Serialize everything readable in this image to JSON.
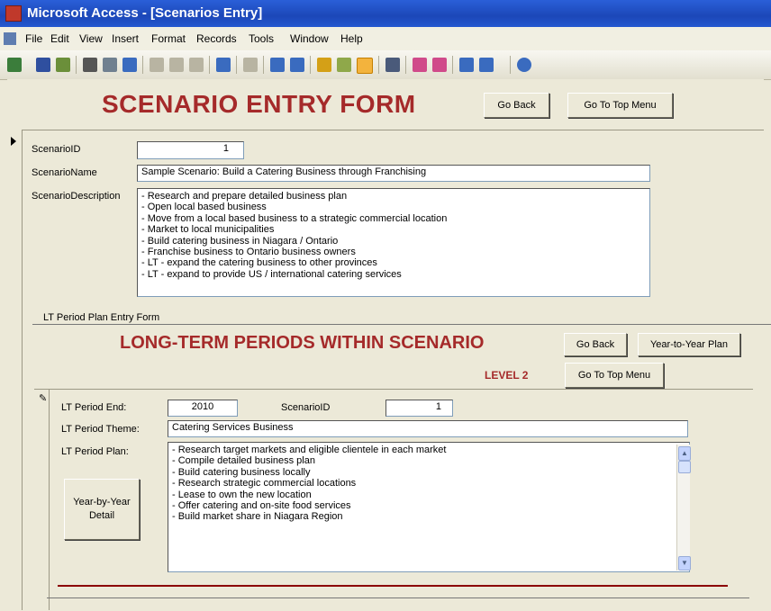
{
  "window": {
    "title": "Microsoft Access - [Scenarios Entry]"
  },
  "menu": [
    "File",
    "Edit",
    "View",
    "Insert",
    "Format",
    "Records",
    "Tools",
    "Window",
    "Help"
  ],
  "toolbar": {
    "icons": [
      "view-icon",
      "save-icon",
      "search-icon",
      "print-icon",
      "print-preview-icon",
      "spelling-icon",
      "cut-icon",
      "copy-icon",
      "paste-icon",
      "undo-icon",
      "insert-hyperlink-icon",
      "sort-ascending-icon",
      "sort-descending-icon",
      "filter-by-selection-icon",
      "filter-by-form-icon",
      "apply-filter-icon",
      "find-icon",
      "new-record-icon",
      "delete-record-icon",
      "database-window-icon",
      "new-object-icon",
      "help-icon"
    ]
  },
  "form": {
    "title": "SCENARIO ENTRY FORM",
    "go_back": "Go Back",
    "go_top_menu": "Go To Top Menu",
    "fields": {
      "scenario_id_label": "ScenarioID",
      "scenario_id_value": "1",
      "scenario_name_label": "ScenarioName",
      "scenario_name_value": "Sample Scenario:  Build a Catering Business through Franchising",
      "scenario_desc_label": "ScenarioDescription",
      "scenario_desc_lines": [
        "- Research and prepare detailed business plan",
        "- Open local based business",
        "- Move from a local based business to a strategic commercial location",
        "- Market to local municipalities",
        "- Build catering business in Niagara / Ontario",
        "- Franchise business to Ontario business owners",
        "- LT - expand the catering business to other provinces",
        "- LT - expand to provide US / international catering services"
      ]
    }
  },
  "subform": {
    "label": "LT Period  Plan Entry Form",
    "title": "LONG-TERM PERIODS WITHIN SCENARIO",
    "level": "LEVEL 2",
    "go_back": "Go Back",
    "year_plan": "Year-to-Year Plan",
    "go_top_menu": "Go To Top Menu",
    "lt_end_label": "LT Period End:",
    "lt_end_value": "2010",
    "scenario_id_label": "ScenarioID",
    "scenario_id_value": "1",
    "lt_theme_label": "LT Period Theme:",
    "lt_theme_value": "Catering Services Business",
    "lt_plan_label": "LT Period Plan:",
    "lt_plan_lines": [
      "- Research target markets and eligible clientele in each market",
      "- Compile detailed business plan",
      "- Build catering business locally",
      "- Research strategic commercial locations",
      "- Lease to own the new location",
      "- Offer catering and on-site food services",
      "- Build market share in Niagara Region"
    ],
    "year_detail": "Year-by-Year Detail"
  },
  "colors": {
    "accent": "#a52a2a",
    "titlebar": "#2458d0",
    "background": "#ece9d8"
  }
}
